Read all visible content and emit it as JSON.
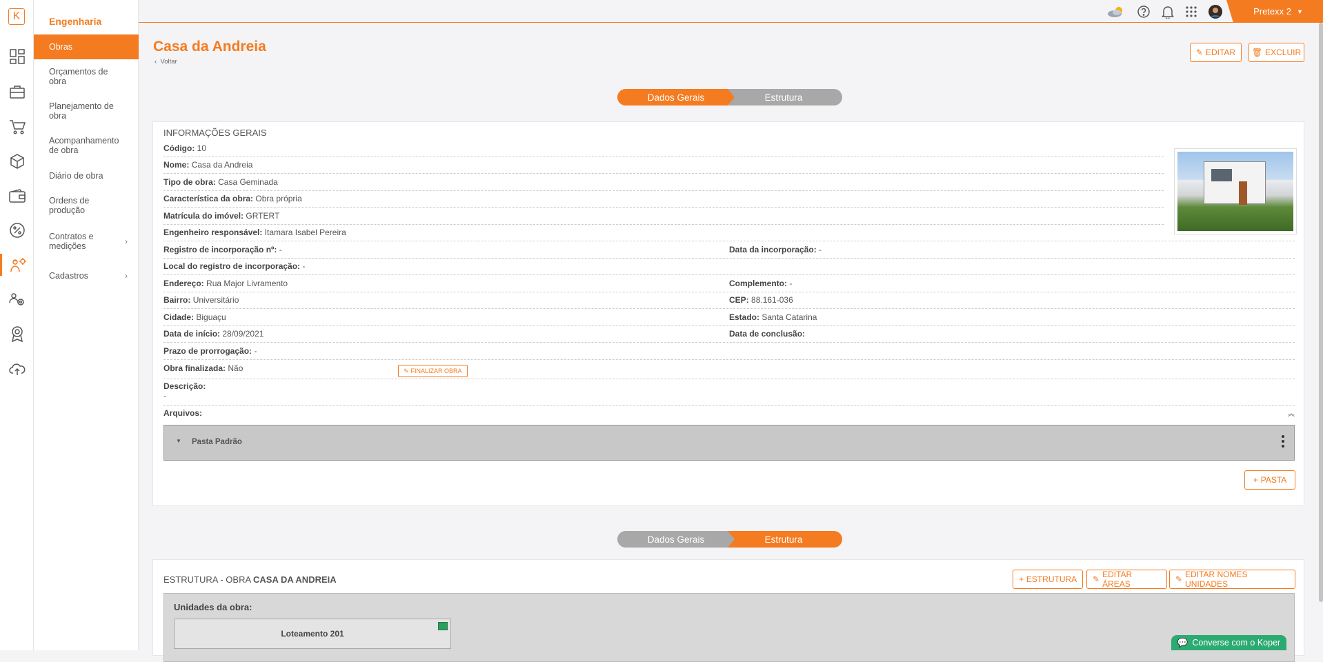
{
  "colors": {
    "accent": "#f47b20",
    "chat": "#2baa72"
  },
  "rail": {
    "logo": "K",
    "icons": [
      "dashboard-icon",
      "briefcase-icon",
      "cart-icon",
      "box-icon",
      "wallet-icon",
      "percent-icon",
      "engineering-icon",
      "settings-people-icon",
      "award-icon",
      "cloud-upload-icon"
    ]
  },
  "sidebar": {
    "title": "Engenharia",
    "items": [
      {
        "label": "Obras"
      },
      {
        "label": "Orçamentos de obra"
      },
      {
        "label": "Planejamento de obra"
      },
      {
        "label": "Acompanhamento de obra"
      },
      {
        "label": "Diário de obra"
      },
      {
        "label": "Ordens de produção"
      },
      {
        "label": "Contratos e medições"
      },
      {
        "label": "Cadastros"
      }
    ]
  },
  "topbar": {
    "user": "Pretexx 2"
  },
  "header": {
    "title": "Casa da Andreia",
    "back": "Voltar",
    "edit": "EDITAR",
    "delete": "EXCLUIR"
  },
  "stepper": {
    "step1": "Dados Gerais",
    "step2": "Estrutura"
  },
  "info": {
    "heading": "INFORMAÇÕES GERAIS",
    "codigo": {
      "label": "Código:",
      "value": "10"
    },
    "nome": {
      "label": "Nome:",
      "value": "Casa da Andreia"
    },
    "tipo": {
      "label": "Tipo de obra:",
      "value": "Casa Geminada"
    },
    "caracteristica": {
      "label": "Característica da obra:",
      "value": "Obra própria"
    },
    "matricula": {
      "label": "Matrícula do imóvel:",
      "value": "GRTERT"
    },
    "engenheiro": {
      "label": "Engenheiro responsável:",
      "value": "Itamara Isabel Pereira"
    },
    "registro": {
      "label": "Registro de incorporação nº:",
      "value": "-"
    },
    "data_incorporacao": {
      "label": "Data da incorporação:",
      "value": "-"
    },
    "local_registro": {
      "label": "Local do registro de incorporação:",
      "value": "-"
    },
    "endereco": {
      "label": "Endereço:",
      "value": "Rua Major Livramento"
    },
    "complemento": {
      "label": "Complemento:",
      "value": "-"
    },
    "bairro": {
      "label": "Bairro:",
      "value": "Universitário"
    },
    "cep": {
      "label": "CEP:",
      "value": "88.161-036"
    },
    "cidade": {
      "label": "Cidade:",
      "value": "Biguaçu"
    },
    "estado": {
      "label": "Estado:",
      "value": "Santa Catarina"
    },
    "data_inicio": {
      "label": "Data de início:",
      "value": "28/09/2021"
    },
    "data_conclusao": {
      "label": "Data de conclusão:",
      "value": ""
    },
    "prazo": {
      "label": "Prazo de prorrogação:",
      "value": "-"
    },
    "finalizada": {
      "label": "Obra finalizada:",
      "value": "Não"
    },
    "finalizar_btn": "FINALIZAR OBRA",
    "descricao": {
      "label": "Descrição:",
      "value": "-"
    },
    "arquivos": {
      "label": "Arquivos:"
    },
    "folder": "Pasta Padrão",
    "add_folder": "PASTA"
  },
  "estrutura": {
    "heading_prefix": "ESTRUTURA - OBRA ",
    "heading_name": "CASA DA ANDREIA",
    "add_btn": "ESTRUTURA",
    "edit_areas": "EDITAR ÁREAS",
    "edit_names": "EDITAR NOMES UNIDADES",
    "units_label": "Unidades da obra:",
    "units": [
      {
        "name": "Loteamento 201"
      }
    ]
  },
  "chat": {
    "label": "Converse com o Koper"
  }
}
